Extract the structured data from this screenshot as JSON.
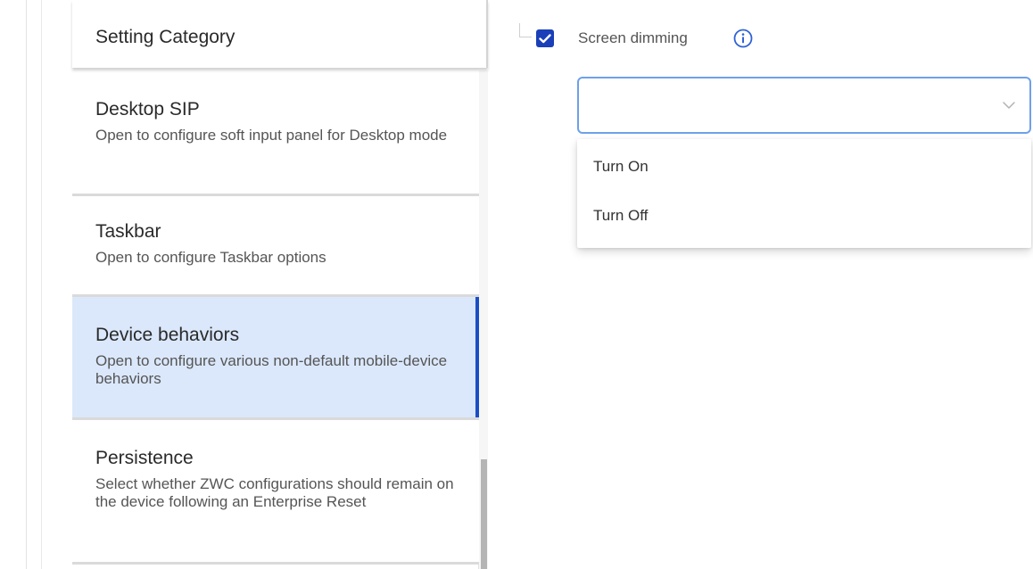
{
  "category_panel": {
    "header_title": "Setting Category",
    "items": [
      {
        "title": "Desktop SIP",
        "description": "Open to configure soft input panel for Desktop mode",
        "selected": false
      },
      {
        "title": "Taskbar",
        "description": "Open to configure Taskbar options",
        "selected": false
      },
      {
        "title": "Device behaviors",
        "description": "Open to configure various non-default mobile-device behaviors",
        "selected": true
      },
      {
        "title": "Persistence",
        "description": "Select whether ZWC configurations should remain on the device following an Enterprise Reset",
        "selected": false
      }
    ]
  },
  "setting": {
    "label": "Screen dimming",
    "checked": true,
    "info_icon": "info-icon",
    "select": {
      "value": "",
      "open": true,
      "options": [
        "Turn On",
        "Turn Off"
      ]
    }
  },
  "colors": {
    "accent": "#1a3fb8",
    "selected_bg": "#dbe8fb",
    "selected_marker": "#1a4fc4",
    "focus_border": "#6ea1ea"
  }
}
